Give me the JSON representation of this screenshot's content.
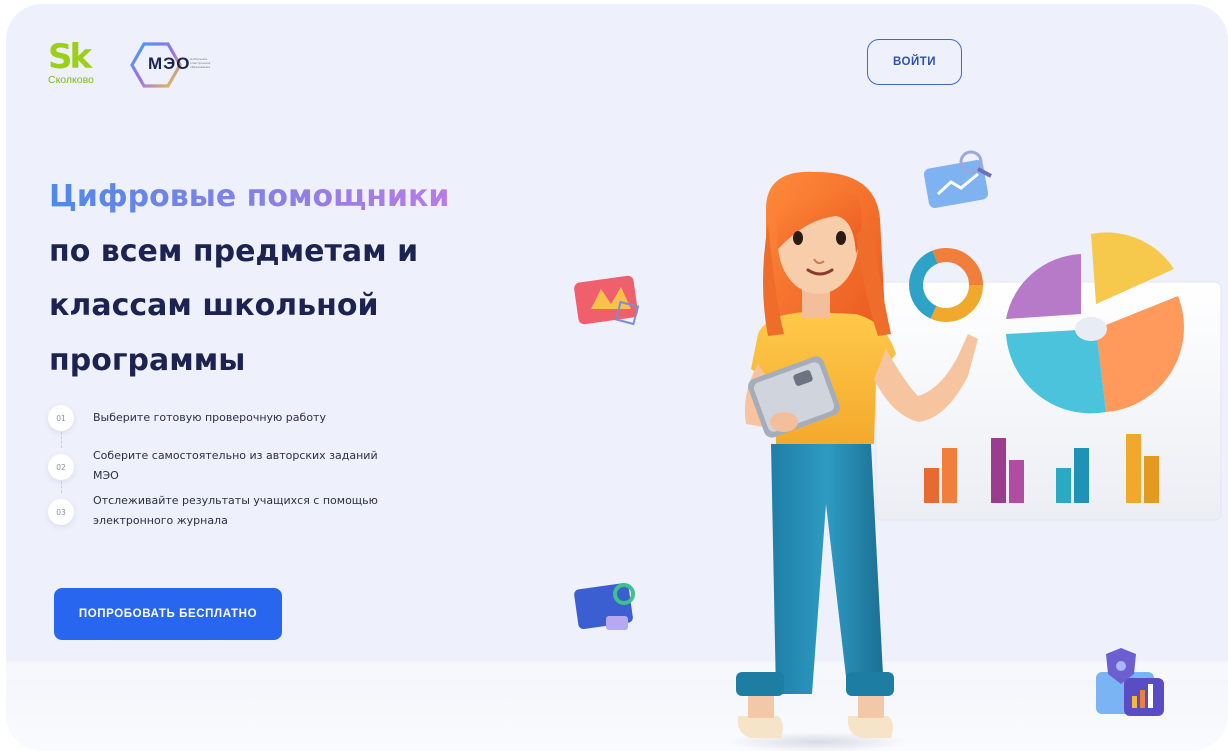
{
  "header": {
    "skolkovo_logo": {
      "mark": "Sk",
      "caption": "Сколково"
    },
    "meo_logo": {
      "name": "МЭО",
      "tagline": "мобильное электронное образование"
    },
    "login_label": "ВОЙТИ"
  },
  "hero": {
    "title_highlight": "Цифровые помощники",
    "title_line2": "по всем предметам и",
    "title_line3": "классам школьной",
    "title_line4": "программы"
  },
  "steps": [
    {
      "num": "01",
      "text": "Выберите готовую проверочную работу"
    },
    {
      "num": "02",
      "text": "Соберите самостоятельно из авторских заданий МЭО"
    },
    {
      "num": "03",
      "text": "Отслеживайте результаты учащихся с помощью электронного журнала"
    }
  ],
  "cta_label": "ПОПРОБОВАТЬ БЕСПЛАТНО",
  "colors": {
    "accent": "#2866ef",
    "heading": "#1c2351",
    "gradient_start": "#4f8ae8",
    "gradient_end": "#c47ae8",
    "background": "#eef1fb"
  },
  "illustration": {
    "main": "teacher-with-tablet-3d",
    "props": [
      "pie-chart",
      "donut-chart",
      "bar-charts-board",
      "magnifier-card",
      "chart-card",
      "folder-card",
      "shield-card"
    ]
  }
}
